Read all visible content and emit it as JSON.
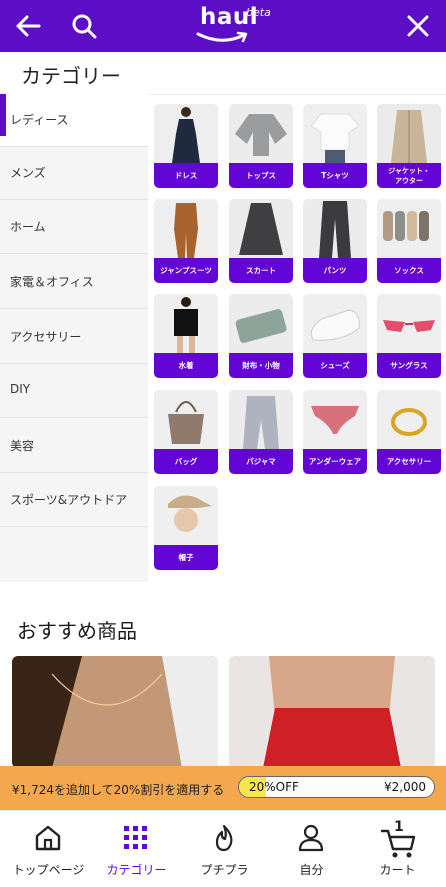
{
  "header": {
    "logo_text": "haul",
    "logo_badge": "beta"
  },
  "page_title": "カテゴリー",
  "sidebar": {
    "items": [
      {
        "label": "レディース",
        "active": true
      },
      {
        "label": "メンズ"
      },
      {
        "label": "ホーム"
      },
      {
        "label": "家電＆オフィス"
      },
      {
        "label": "アクセサリー"
      },
      {
        "label": "DIY"
      },
      {
        "label": "美容"
      },
      {
        "label": "スポーツ&アウトドア"
      }
    ]
  },
  "categories": [
    {
      "label": "ドレス",
      "icon": "dress-image"
    },
    {
      "label": "トップス",
      "icon": "top-image"
    },
    {
      "label": "Tシャツ",
      "icon": "tshirt-image"
    },
    {
      "label": "ジャケット・\nアウター",
      "icon": "jacket-image"
    },
    {
      "label": "ジャンプスーツ",
      "icon": "jumpsuit-image"
    },
    {
      "label": "スカート",
      "icon": "skirt-image"
    },
    {
      "label": "パンツ",
      "icon": "pants-image"
    },
    {
      "label": "ソックス",
      "icon": "socks-image"
    },
    {
      "label": "水着",
      "icon": "swimsuit-image"
    },
    {
      "label": "財布・小物",
      "icon": "wallet-image"
    },
    {
      "label": "シューズ",
      "icon": "shoes-image"
    },
    {
      "label": "サングラス",
      "icon": "sunglasses-image"
    },
    {
      "label": "バッグ",
      "icon": "bag-image"
    },
    {
      "label": "パジャマ",
      "icon": "pajama-image"
    },
    {
      "label": "アンダーウェア",
      "icon": "underwear-image"
    },
    {
      "label": "アクセサリー",
      "icon": "ring-image"
    },
    {
      "label": "帽子",
      "icon": "hat-image"
    }
  ],
  "recommended": {
    "title": "おすすめ商品"
  },
  "promo": {
    "message": "¥1,724を追加して20%割引を適用する",
    "discount_label": "20%OFF",
    "target_amount": "¥2,000",
    "progress": 0.14
  },
  "bottom_nav": [
    {
      "label": "トップページ",
      "icon": "home-icon"
    },
    {
      "label": "カテゴリー",
      "icon": "grid-icon",
      "active": true
    },
    {
      "label": "プチプラ",
      "icon": "flame-icon"
    },
    {
      "label": "自分",
      "icon": "user-icon"
    },
    {
      "label": "カート",
      "icon": "cart-icon",
      "badge": "1"
    }
  ],
  "colors": {
    "brand": "#5c0ec7",
    "label_bg": "#6205d6",
    "promo_bg": "#f3a84d",
    "progress": "#f6e84b"
  }
}
